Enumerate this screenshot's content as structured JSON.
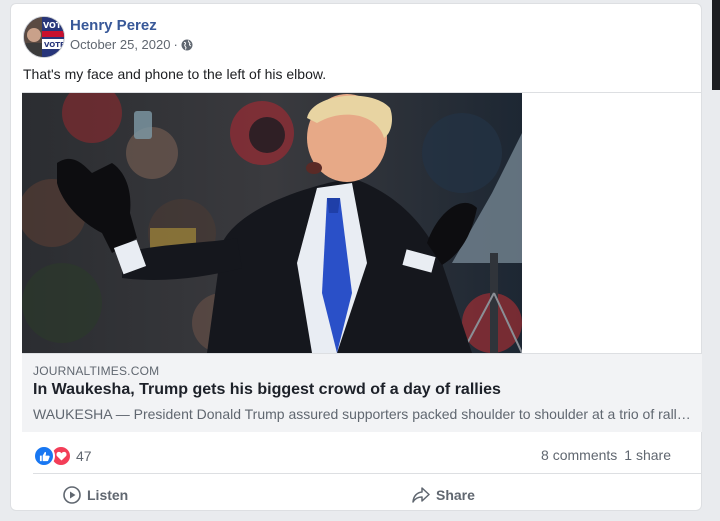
{
  "post": {
    "author": "Henry Perez",
    "date": "October 25, 2020",
    "separator": "·",
    "privacy_icon": "globe-icon",
    "avatar_text": {
      "line1": "VOTE",
      "line2": "VOTE"
    },
    "text": "That's my face and phone to the left of his elbow."
  },
  "link": {
    "domain": "JOURNALTIMES.COM",
    "headline": "In Waukesha, Trump gets his biggest crowd of a day of rallies",
    "description": "WAUKESHA — President Donald Trump assured supporters packed shoulder to shoulder at a trio of rallies in battleground states Saturday, and in Waukesha he drew his biggest crowd of the day."
  },
  "reactions": {
    "icons": [
      "like-icon",
      "love-icon"
    ],
    "count": "47",
    "comments": "8 comments",
    "shares": "1 share"
  },
  "actions": {
    "listen": "Listen",
    "share": "Share"
  },
  "colors": {
    "name_link": "#385898",
    "like": "#1877f2",
    "love": "#f33e58",
    "secondary_text": "#606770"
  }
}
